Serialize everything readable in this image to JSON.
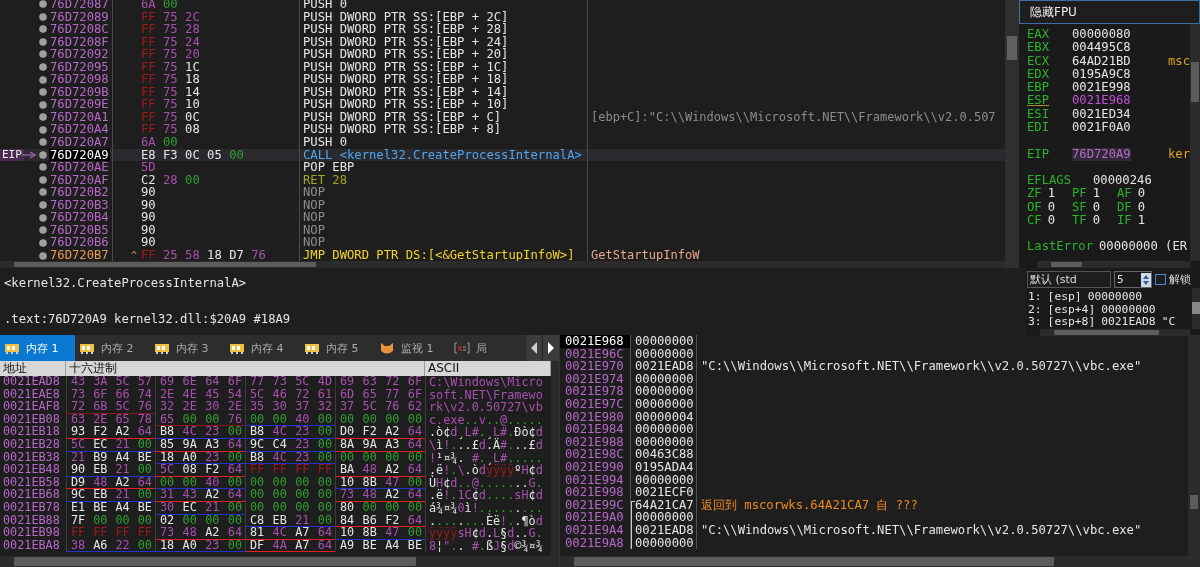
{
  "disassembly": {
    "eip_label": "EIP",
    "rows": [
      {
        "address": "76D72087",
        "bytes": "6A 00",
        "instruction": "PUSH 0",
        "kind": "push",
        "current": false
      },
      {
        "address": "76D72089",
        "bytes": "FF 75 2C",
        "instruction": "PUSH DWORD PTR SS:[EBP + 2C]",
        "kind": "push",
        "current": false
      },
      {
        "address": "76D7208C",
        "bytes": "FF 75 28",
        "instruction": "PUSH DWORD PTR SS:[EBP + 28]",
        "kind": "push",
        "current": false
      },
      {
        "address": "76D7208F",
        "bytes": "FF 75 24",
        "instruction": "PUSH DWORD PTR SS:[EBP + 24]",
        "kind": "push",
        "current": false
      },
      {
        "address": "76D72092",
        "bytes": "FF 75 20",
        "instruction": "PUSH DWORD PTR SS:[EBP + 20]",
        "kind": "push",
        "current": false
      },
      {
        "address": "76D72095",
        "bytes": "FF 75 1C",
        "instruction": "PUSH DWORD PTR SS:[EBP + 1C]",
        "kind": "push",
        "current": false
      },
      {
        "address": "76D72098",
        "bytes": "FF 75 18",
        "instruction": "PUSH DWORD PTR SS:[EBP + 18]",
        "kind": "push",
        "current": false
      },
      {
        "address": "76D7209B",
        "bytes": "FF 75 14",
        "instruction": "PUSH DWORD PTR SS:[EBP + 14]",
        "kind": "push",
        "current": false
      },
      {
        "address": "76D7209E",
        "bytes": "FF 75 10",
        "instruction": "PUSH DWORD PTR SS:[EBP + 10]",
        "kind": "push",
        "current": false
      },
      {
        "address": "76D720A1",
        "bytes": "FF 75 0C",
        "instruction": "PUSH DWORD PTR SS:[EBP + C]",
        "kind": "push",
        "current": false,
        "comment": {
          "text": "[ebp+C]:\"C:\\\\Windows\\\\Microsoft.NET\\\\Framework\\\\v2.0.507",
          "kind": "auto"
        }
      },
      {
        "address": "76D720A4",
        "bytes": "FF 75 08",
        "instruction": "PUSH DWORD PTR SS:[EBP + 8]",
        "kind": "push",
        "current": false
      },
      {
        "address": "76D720A7",
        "bytes": "6A 00",
        "instruction": "PUSH 0",
        "kind": "push",
        "current": false
      },
      {
        "address": "76D720A9",
        "bytes": "E8 F3 0C 05 00",
        "instruction": "CALL <kernel32.CreateProcessInternalA>",
        "kind": "call",
        "current": true
      },
      {
        "address": "76D720AE",
        "bytes": "5D",
        "instruction": "POP EBP",
        "kind": "pop",
        "current": false
      },
      {
        "address": "76D720AF",
        "bytes": "C2 28 00",
        "instruction": "RET 28",
        "kind": "ret",
        "current": false
      },
      {
        "address": "76D720B2",
        "bytes": "90",
        "instruction": "NOP",
        "kind": "nop",
        "current": false
      },
      {
        "address": "76D720B3",
        "bytes": "90",
        "instruction": "NOP",
        "kind": "nop",
        "current": false
      },
      {
        "address": "76D720B4",
        "bytes": "90",
        "instruction": "NOP",
        "kind": "nop",
        "current": false
      },
      {
        "address": "76D720B5",
        "bytes": "90",
        "instruction": "NOP",
        "kind": "nop",
        "current": false
      },
      {
        "address": "76D720B6",
        "bytes": "90",
        "instruction": "NOP",
        "kind": "nop",
        "current": false
      },
      {
        "address": "76D720B7",
        "marker": "^",
        "bytes": "FF 25 58 18 D7 76",
        "instruction": "JMP DWORD PTR DS:[<&GetStartupInfoW>]",
        "kind": "jmp",
        "current": false,
        "comment": {
          "text": "GetStartupInfoW",
          "kind": "symbol"
        }
      }
    ]
  },
  "registers": {
    "fpu_button": "隐藏FPU",
    "general": [
      {
        "name": "EAX",
        "value": "00000080",
        "kind": "plain"
      },
      {
        "name": "EBX",
        "value": "004495C8",
        "kind": "plain"
      },
      {
        "name": "ECX",
        "value": "64AD21BD",
        "kind": "plain",
        "comment": "msc"
      },
      {
        "name": "EDX",
        "value": "0195A9C8",
        "kind": "plain"
      },
      {
        "name": "EBP",
        "value": "0021E998",
        "kind": "plain"
      },
      {
        "name": "ESP",
        "value": "0021E968",
        "kind": "stack"
      },
      {
        "name": "ESI",
        "value": "0021ED34",
        "kind": "plain"
      },
      {
        "name": "EDI",
        "value": "0021F0A0",
        "kind": "plain"
      }
    ],
    "eip": {
      "name": "EIP",
      "value": "76D720A9",
      "kind": "code",
      "comment": "ker"
    },
    "eflags": {
      "name": "EFLAGS",
      "value": "00000246"
    },
    "flags": [
      {
        "name": "ZF",
        "value": "1"
      },
      {
        "name": "PF",
        "value": "1"
      },
      {
        "name": "AF",
        "value": "0"
      },
      {
        "name": "OF",
        "value": "0"
      },
      {
        "name": "SF",
        "value": "0"
      },
      {
        "name": "DF",
        "value": "0"
      },
      {
        "name": "CF",
        "value": "0"
      },
      {
        "name": "TF",
        "value": "0"
      },
      {
        "name": "IF",
        "value": "1"
      }
    ],
    "last_error": {
      "name": "LastError",
      "value": "00000000 (ER"
    }
  },
  "call_args": {
    "convention": "默认 (std",
    "count": "5",
    "unlock": {
      "label": "解锁",
      "checked": false
    },
    "rows": [
      {
        "index": "1:",
        "location": "[esp]",
        "value": "00000000"
      },
      {
        "index": "2:",
        "location": "[esp+4]",
        "value": "00000000"
      },
      {
        "index": "3:",
        "location": "[esp+8]",
        "value": "0021EAD8",
        "comment": "\"C"
      }
    ]
  },
  "info": {
    "lines": [
      "<kernel32.CreateProcessInternalA>",
      ".text:76D720A9 kernel32.dll:$20A9 #18A9"
    ]
  },
  "tabs": [
    {
      "label": "内存 1",
      "kind": "memory",
      "selected": true
    },
    {
      "label": "内存 2",
      "kind": "memory",
      "selected": false
    },
    {
      "label": "内存 3",
      "kind": "memory",
      "selected": false
    },
    {
      "label": "内存 4",
      "kind": "memory",
      "selected": false
    },
    {
      "label": "内存 5",
      "kind": "memory",
      "selected": false
    },
    {
      "label": "监视 1",
      "kind": "watch",
      "selected": false
    },
    {
      "label": "局",
      "kind": "locals",
      "selected": false
    }
  ],
  "dump": {
    "columns": [
      "地址",
      "十六进制",
      "ASCII"
    ],
    "rows": [
      {
        "address": "0021EAD8",
        "groups": [
          {
            "hex": "43 3A 5C 57"
          },
          {
            "hex": "69 6E 64 6F"
          },
          {
            "hex": "77 73 5C 4D"
          },
          {
            "hex": "69 63 72 6F"
          }
        ],
        "ascii": "C:\\Windows\\Micro"
      },
      {
        "address": "0021EAE8",
        "groups": [
          {
            "hex": "73 6F 66 74"
          },
          {
            "hex": "2E 4E 45 54"
          },
          {
            "hex": "5C 46 72 61"
          },
          {
            "hex": "6D 65 77 6F"
          }
        ],
        "ascii": "soft.NET\\Framewo"
      },
      {
        "address": "0021EAF8",
        "groups": [
          {
            "hex": "72 6B 5C 76",
            "color": "#8a1818"
          },
          {
            "hex": "32 2E 30 2E"
          },
          {
            "hex": "35 30 37 32"
          },
          {
            "hex": "37 5C 76 62"
          }
        ],
        "ascii": "rk\\v2.0.50727\\vb"
      },
      {
        "address": "0021EB08",
        "groups": [
          {
            "hex": "63 2E 65 78"
          },
          {
            "hex": "65 00 00 76",
            "color": "#8a1818"
          },
          {
            "hex": "00 00 40 00",
            "color": "#2233cc"
          },
          {
            "hex": "00 00 00 00"
          }
        ],
        "ascii": "c.exe..v..@....."
      },
      {
        "address": "0021EB18",
        "groups": [
          {
            "hex": "93 F2 A2 64",
            "color": "#e02020"
          },
          {
            "hex": "B8 4C 23 00",
            "color": "#2233cc"
          },
          {
            "hex": "B8 4C 23 00",
            "color": "#2233cc"
          },
          {
            "hex": "D0 F2 A2 64",
            "color": "#e02020"
          }
        ],
        "ascii": ".ò¢d¸L#.¸L#.Ðò¢d"
      },
      {
        "address": "0021EB28",
        "groups": [
          {
            "hex": "5C EC 21 00",
            "color": "#2233cc"
          },
          {
            "hex": "85 9A A3 64",
            "color": "#e02020"
          },
          {
            "hex": "9C C4 23 00",
            "color": "#2233cc"
          },
          {
            "hex": "8A 9A A3 64",
            "color": "#e02020"
          }
        ],
        "ascii": "\\ì!...£d.Ä#...£d"
      },
      {
        "address": "0021EB38",
        "groups": [
          {
            "hex": "21 B9 A4 BE"
          },
          {
            "hex": "18 A0 23 00",
            "color": "#2233cc"
          },
          {
            "hex": "B8 4C 23 00",
            "color": "#2233cc"
          },
          {
            "hex": "00 00 00 00"
          }
        ],
        "ascii": "!¹¤¾. #.¸L#....."
      },
      {
        "address": "0021EB48",
        "groups": [
          {
            "hex": "90 EB 21 00",
            "color": "#2233cc"
          },
          {
            "hex": "5C 08 F2 64",
            "color": "#e02020"
          },
          {
            "hex": "FF FF FF FF"
          },
          {
            "hex": "BA 48 A2 64",
            "color": "#e02020"
          }
        ],
        "ascii": ".ë!.\\.òdÿÿÿÿºH¢d"
      },
      {
        "address": "0021EB58",
        "groups": [
          {
            "hex": "D9 48 A2 64",
            "color": "#e02020"
          },
          {
            "hex": "00 00 40 00",
            "color": "#2233cc"
          },
          {
            "hex": "00 00 00 00"
          },
          {
            "hex": "10 8B 47 00",
            "color": "#2233cc"
          }
        ],
        "ascii": "ÙH¢d..@.......G."
      },
      {
        "address": "0021EB68",
        "groups": [
          {
            "hex": "9C EB 21 00",
            "color": "#2233cc"
          },
          {
            "hex": "31 43 A2 64",
            "color": "#e02020"
          },
          {
            "hex": "00 00 00 00"
          },
          {
            "hex": "73 48 A2 64",
            "color": "#e02020"
          }
        ],
        "ascii": ".ë!.1C¢d....sH¢d"
      },
      {
        "address": "0021EB78",
        "groups": [
          {
            "hex": "E1 BE A4 BE"
          },
          {
            "hex": "30 EC 21 00",
            "color": "#2233cc"
          },
          {
            "hex": "00 00 00 00"
          },
          {
            "hex": "80 00 00 00"
          }
        ],
        "ascii": "á¾¤¾0ì!........."
      },
      {
        "address": "0021EB88",
        "groups": [
          {
            "hex": "7F 00 00 00"
          },
          {
            "hex": "02 00 00 00"
          },
          {
            "hex": "C8 EB 21 00",
            "color": "#2233cc"
          },
          {
            "hex": "84 B6 F2 64",
            "color": "#e02020"
          }
        ],
        "ascii": "........Èë!..¶òd"
      },
      {
        "address": "0021EB98",
        "groups": [
          {
            "hex": "FF FF FF FF"
          },
          {
            "hex": "73 48 A2 64",
            "color": "#e02020"
          },
          {
            "hex": "81 4C A7 64",
            "color": "#e02020"
          },
          {
            "hex": "10 8B 47 00",
            "color": "#2233cc"
          }
        ],
        "ascii": "ÿÿÿÿsH¢d.L§d..G."
      },
      {
        "address": "0021EBA8",
        "groups": [
          {
            "hex": "38 A6 22 00",
            "color": "#2233cc"
          },
          {
            "hex": "18 A0 23 00",
            "color": "#2233cc"
          },
          {
            "hex": "DF 4A A7 64",
            "color": "#e02020"
          },
          {
            "hex": "A9 BE A4 BE"
          }
        ],
        "ascii": "8¦\".. #.ßJ§d©¾¤¾"
      }
    ]
  },
  "stack": {
    "rows": [
      {
        "address": "0021E968",
        "value": "00000000",
        "selected": true
      },
      {
        "address": "0021E96C",
        "value": "00000000",
        "selected": false
      },
      {
        "address": "0021E970",
        "value": "0021EAD8",
        "selected": false,
        "comment": {
          "text": "\"C:\\\\Windows\\\\Microsoft.NET\\\\Framework\\\\v2.0.50727\\\\vbc.exe\"",
          "kind": "string"
        }
      },
      {
        "address": "0021E974",
        "value": "00000000",
        "selected": false
      },
      {
        "address": "0021E978",
        "value": "00000000",
        "selected": false
      },
      {
        "address": "0021E97C",
        "value": "00000000",
        "selected": false
      },
      {
        "address": "0021E980",
        "value": "00000004",
        "selected": false
      },
      {
        "address": "0021E984",
        "value": "00000000",
        "selected": false
      },
      {
        "address": "0021E988",
        "value": "00000000",
        "selected": false
      },
      {
        "address": "0021E98C",
        "value": "00463C88",
        "selected": false
      },
      {
        "address": "0021E990",
        "value": "0195ADA4",
        "selected": false
      },
      {
        "address": "0021E994",
        "value": "00000000",
        "selected": false
      },
      {
        "address": "0021E998",
        "value": "0021ECF0",
        "selected": false
      },
      {
        "address": "0021E99C",
        "value": "64A21CA7",
        "selected": false,
        "kind": "frame_start",
        "comment": {
          "text": "返回到 mscorwks.64A21CA7 自 ???",
          "kind": "return"
        }
      },
      {
        "address": "0021E9A0",
        "value": "00000000",
        "selected": false,
        "kind": "frame_inside"
      },
      {
        "address": "0021E9A4",
        "value": "0021EAD8",
        "selected": false,
        "kind": "frame_inside",
        "comment": {
          "text": "\"C:\\\\Windows\\\\Microsoft.NET\\\\Framework\\\\v2.0.50727\\\\vbc.exe\"",
          "kind": "string"
        }
      },
      {
        "address": "0021E9A8",
        "value": "00000000",
        "selected": false,
        "kind": "frame_inside"
      }
    ]
  }
}
